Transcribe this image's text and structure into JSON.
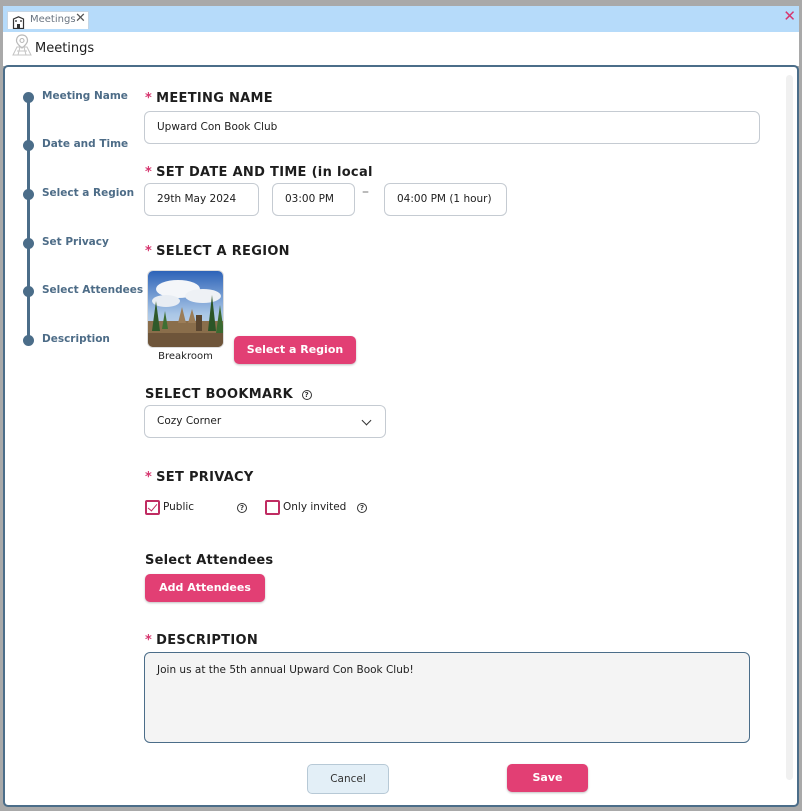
{
  "tab": {
    "label": "Meetings",
    "icon": "building-icon",
    "close": "✕"
  },
  "window": {
    "close": "✕",
    "accent_color": "#e23f74"
  },
  "title": {
    "text": "Meetings",
    "icon": "map-pin-icon"
  },
  "steps": [
    {
      "label": "Meeting Name"
    },
    {
      "label": "Date and Time"
    },
    {
      "label": "Select a Region"
    },
    {
      "label": "Set Privacy"
    },
    {
      "label": "Select Attendees"
    },
    {
      "label": "Description"
    }
  ],
  "required_mark": "*",
  "meeting_name": {
    "title": "MEETING NAME",
    "value": "Upward Con Book Club"
  },
  "date_time": {
    "title": "SET DATE AND TIME (in local",
    "date": "29th May 2024",
    "start": "03:00 PM",
    "separator": "–",
    "end": "04:00 PM (1 hour)"
  },
  "region": {
    "title": "SELECT A REGION",
    "selected": "Breakroom",
    "button": "Select a Region"
  },
  "bookmark": {
    "title": "SELECT BOOKMARK",
    "help": "?",
    "selected": "Cozy Corner"
  },
  "privacy": {
    "title": "SET PRIVACY",
    "help": "?",
    "options": [
      {
        "label": "Public",
        "checked": true
      },
      {
        "label": "Only invited",
        "checked": false
      }
    ]
  },
  "attendees": {
    "title": "Select Attendees",
    "button": "Add Attendees"
  },
  "description": {
    "title": "DESCRIPTION",
    "value": "Join us at the 5th annual Upward Con Book Club!"
  },
  "footer": {
    "cancel": "Cancel",
    "save": "Save"
  }
}
